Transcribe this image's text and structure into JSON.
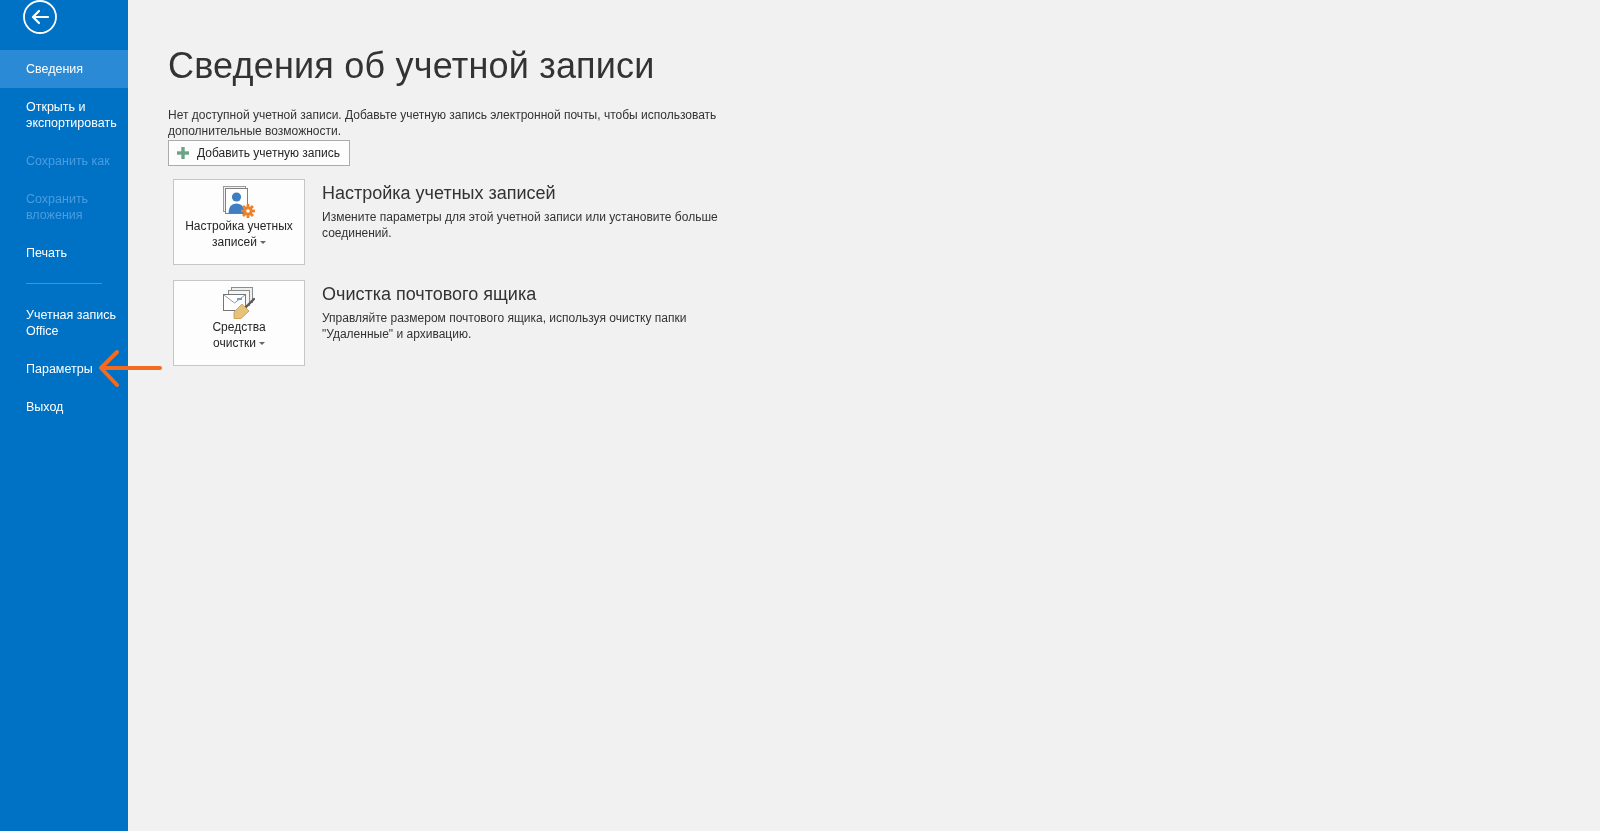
{
  "sidebar": {
    "sections": [
      {
        "items": [
          {
            "label": "Сведения",
            "selected": true,
            "disabled": false
          },
          {
            "label": "Открыть и экспортировать",
            "selected": false,
            "disabled": false
          },
          {
            "label": "Сохранить как",
            "selected": false,
            "disabled": true
          },
          {
            "label": "Сохранить вложения",
            "selected": false,
            "disabled": true
          },
          {
            "label": "Печать",
            "selected": false,
            "disabled": false
          }
        ]
      },
      {
        "items": [
          {
            "label": "Учетная запись Office",
            "selected": false,
            "disabled": false
          },
          {
            "label": "Параметры",
            "selected": false,
            "disabled": false
          },
          {
            "label": "Выход",
            "selected": false,
            "disabled": false
          }
        ]
      }
    ]
  },
  "main": {
    "title": "Сведения об учетной записи",
    "notice": "Нет доступной учетной записи. Добавьте учетную запись электронной почты, чтобы использовать дополнительные возможности.",
    "add_button": {
      "label": "Добавить учетную запись"
    },
    "actions": [
      {
        "kind": "account-settings",
        "label_lines": [
          "Настройка учетных",
          "записей"
        ],
        "dropdown": true,
        "heading": "Настройка учетных записей",
        "description": "Измените параметры для этой учетной записи или установите больше соединений."
      },
      {
        "kind": "cleanup",
        "label_lines": [
          "Средства",
          "очистки"
        ],
        "dropdown": true,
        "heading": "Очистка почтового ящика",
        "description": "Управляйте размером почтового ящика, используя очистку папки \"Удаленные\" и архивацию."
      }
    ]
  }
}
